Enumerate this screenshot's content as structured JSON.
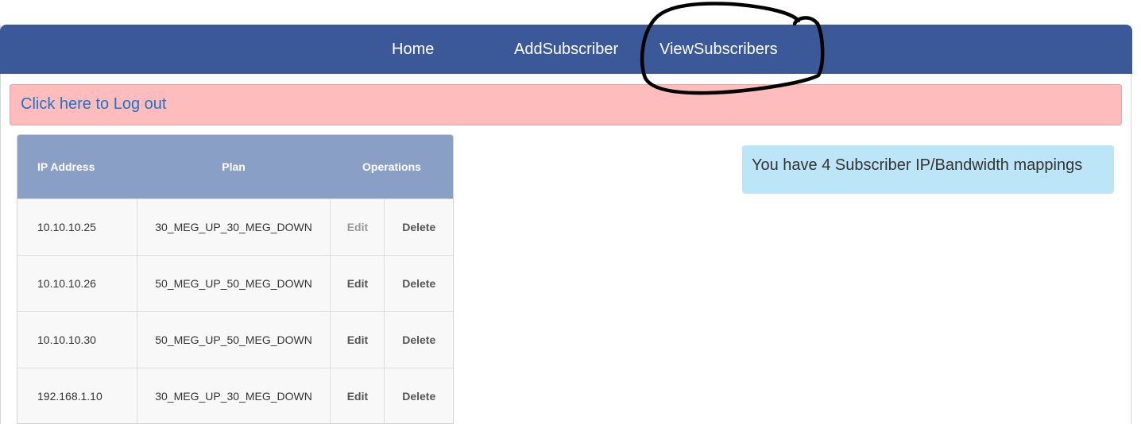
{
  "nav": {
    "items": [
      {
        "label": "Home"
      },
      {
        "label": "AddSubscriber"
      },
      {
        "label": "ViewSubscribers"
      }
    ]
  },
  "logout": {
    "label": "Click here to Log out"
  },
  "table": {
    "headers": {
      "ip": "IP Address",
      "plan": "Plan",
      "operations": "Operations"
    },
    "rows": [
      {
        "ip": "10.10.10.25",
        "plan": "30_MEG_UP_30_MEG_DOWN",
        "edit": "Edit",
        "delete": "Delete"
      },
      {
        "ip": "10.10.10.26",
        "plan": "50_MEG_UP_50_MEG_DOWN",
        "edit": "Edit",
        "delete": "Delete"
      },
      {
        "ip": "10.10.10.30",
        "plan": "50_MEG_UP_50_MEG_DOWN",
        "edit": "Edit",
        "delete": "Delete"
      },
      {
        "ip": "192.168.1.10",
        "plan": "30_MEG_UP_30_MEG_DOWN",
        "edit": "Edit",
        "delete": "Delete"
      }
    ]
  },
  "info": {
    "message": "You have 4 Subscriber IP/Bandwidth mappings"
  },
  "colors": {
    "navbar": "#3b5998",
    "logout_bg": "#ffbcbc",
    "link": "#1a75c9",
    "table_header": "#8a9fc6",
    "info_bg": "#bde5f8",
    "annotation": "#000000"
  }
}
